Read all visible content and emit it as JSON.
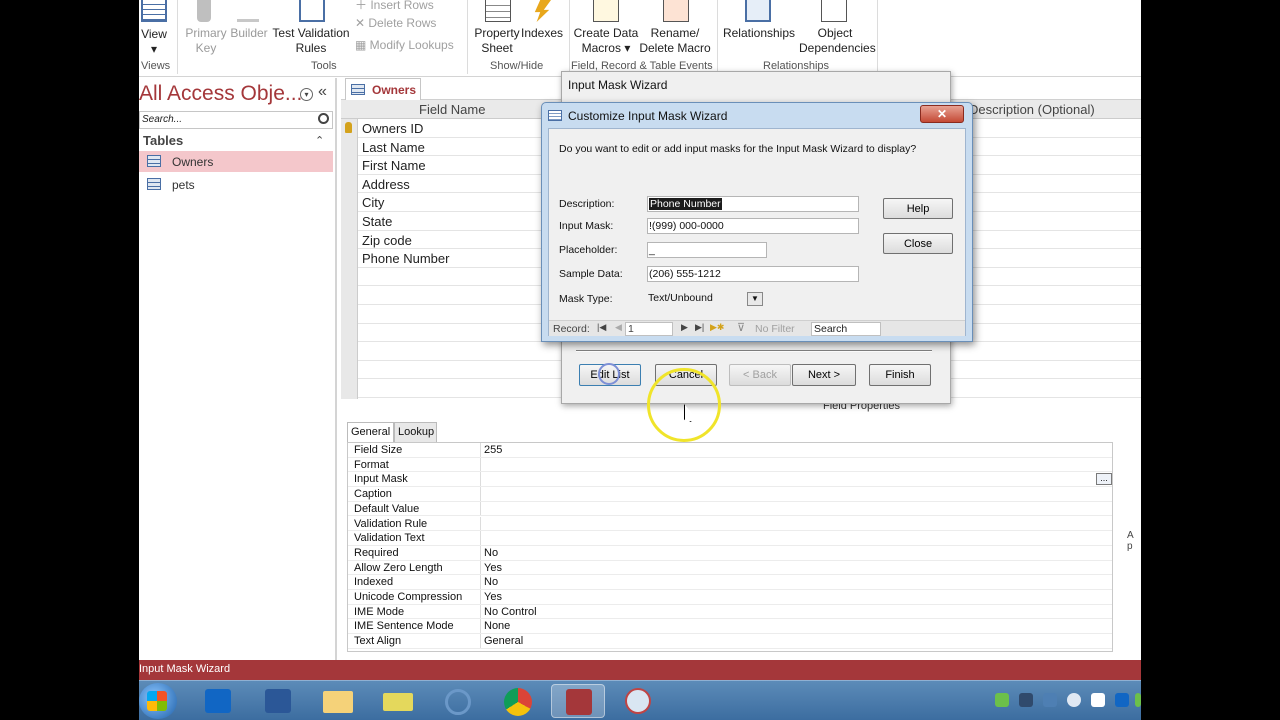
{
  "ribbon": {
    "view_label": "View",
    "primary_key_label": "Primary Key",
    "builder_label": "Builder",
    "test_validation_label": "Test Validation Rules",
    "insert_rows_label": "Insert Rows",
    "delete_rows_label": "Delete Rows",
    "modify_lookups_label": "Modify Lookups",
    "property_sheet_label": "Property Sheet",
    "indexes_label": "Indexes",
    "create_data_macros_label": "Create Data Macros",
    "rename_delete_macro_label": "Rename/ Delete Macro",
    "relationships_label": "Relationships",
    "object_dependencies_label": "Object Dependencies",
    "group_views": "Views",
    "group_tools": "Tools",
    "group_show_hide": "Show/Hide",
    "group_field_record": "Field, Record & Table Events",
    "group_relationships": "Relationships"
  },
  "nav": {
    "title": "All Access Obje...",
    "search_placeholder": "Search...",
    "section": "Tables",
    "items": [
      {
        "label": "Owners"
      },
      {
        "label": "pets"
      }
    ]
  },
  "document": {
    "tab_label": "Owners",
    "field_name_header": "Field Name",
    "description_header": "Description (Optional)",
    "fields": [
      "Owners ID",
      "Last Name",
      "First Name",
      "Address",
      "City",
      "State",
      "Zip code",
      "Phone Number"
    ]
  },
  "wizard": {
    "title": "Input Mask Wizard",
    "edit_list": "Edit List",
    "cancel": "Cancel",
    "back": "< Back",
    "next": "Next >",
    "finish": "Finish"
  },
  "customize": {
    "title": "Customize Input Mask Wizard",
    "close_glyph": "✕",
    "question": "Do you want to edit or add input masks for the Input Mask Wizard to display?",
    "description_label": "Description:",
    "description_value": "Phone Number",
    "input_mask_label": "Input Mask:",
    "input_mask_value": "!(999) 000-0000",
    "placeholder_label": "Placeholder:",
    "placeholder_value": "_",
    "sample_data_label": "Sample Data:",
    "sample_data_value": "(206) 555-1212",
    "mask_type_label": "Mask Type:",
    "mask_type_value": "Text/Unbound",
    "help": "Help",
    "close": "Close",
    "record_label": "Record:",
    "record_value": "1",
    "no_filter": "No Filter",
    "search": "Search"
  },
  "field_properties": {
    "label": "Field Properties",
    "tabs": [
      "General",
      "Lookup"
    ],
    "rows": [
      {
        "key": "Field Size",
        "value": "255"
      },
      {
        "key": "Format",
        "value": ""
      },
      {
        "key": "Input Mask",
        "value": ""
      },
      {
        "key": "Caption",
        "value": ""
      },
      {
        "key": "Default Value",
        "value": ""
      },
      {
        "key": "Validation Rule",
        "value": ""
      },
      {
        "key": "Validation Text",
        "value": ""
      },
      {
        "key": "Required",
        "value": "No"
      },
      {
        "key": "Allow Zero Length",
        "value": "Yes"
      },
      {
        "key": "Indexed",
        "value": "No"
      },
      {
        "key": "Unicode Compression",
        "value": "Yes"
      },
      {
        "key": "IME Mode",
        "value": "No Control"
      },
      {
        "key": "IME Sentence Mode",
        "value": "None"
      },
      {
        "key": "Text Align",
        "value": "General"
      }
    ],
    "ellipsis": "..."
  },
  "side_hint": "A p",
  "status_text": "Input Mask Wizard",
  "colors": {
    "accent": "#a4373a",
    "nav_selected": "#f4c7cb",
    "taskbar": "#3c6da0"
  }
}
